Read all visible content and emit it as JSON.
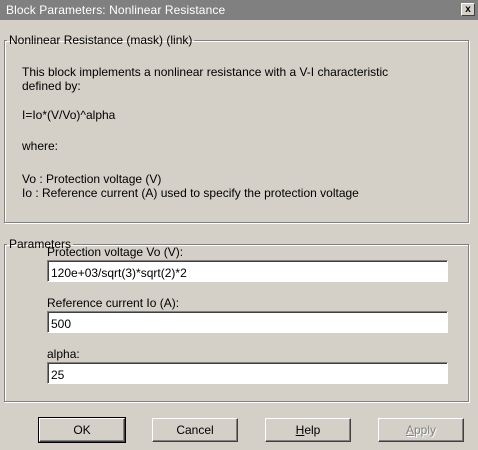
{
  "window": {
    "title": "Block Parameters: Nonlinear Resistance",
    "close_glyph": "x"
  },
  "description": {
    "legend": "Nonlinear Resistance (mask) (link)",
    "lines": [
      "This block implements a nonlinear resistance with  a V-I characteristic",
      "defined by:",
      "I=Io*(V/Vo)^alpha",
      "where:",
      "Vo : Protection voltage (V)",
      "Io : Reference current (A) used to specify the protection voltage"
    ]
  },
  "parameters": {
    "legend": "Parameters",
    "fields": [
      {
        "label": "Protection voltage Vo (V):",
        "value": "120e+03/sqrt(3)*sqrt(2)*2"
      },
      {
        "label": "Reference current Io (A):",
        "value": "500"
      },
      {
        "label": "alpha:",
        "value": "25"
      }
    ]
  },
  "buttons": {
    "ok": "OK",
    "cancel": "Cancel",
    "help_first": "H",
    "help_rest": "elp",
    "apply_first": "A",
    "apply_rest": "pply"
  }
}
